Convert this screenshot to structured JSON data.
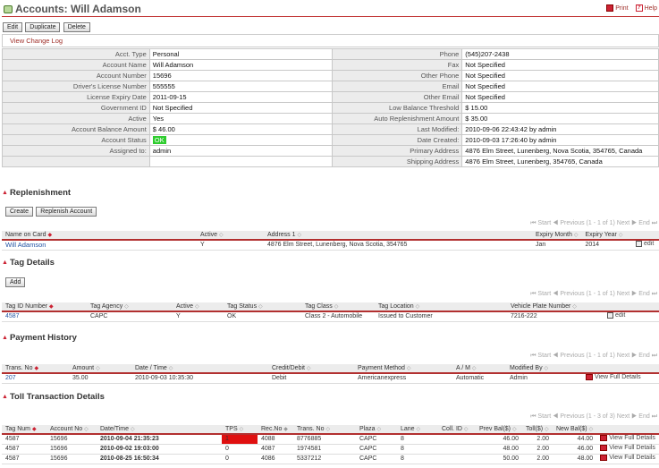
{
  "header": {
    "title": "Accounts: Will Adamson",
    "print": "Print",
    "help": "Help"
  },
  "toolbar": {
    "edit": "Edit",
    "duplicate": "Duplicate",
    "delete": "Delete"
  },
  "change_log": "View Change Log",
  "account": {
    "left": [
      [
        "Acct. Type",
        "Personal"
      ],
      [
        "Account Name",
        "Will Adamson"
      ],
      [
        "Account Number",
        "15696"
      ],
      [
        "Driver's License Number",
        "555555"
      ],
      [
        "License Expiry Date",
        "2011-09-15"
      ],
      [
        "Government ID",
        "Not Specified"
      ],
      [
        "Active",
        "Yes"
      ],
      [
        "Account Balance Amount",
        "$ 46.00"
      ],
      [
        "Account Status",
        "OK"
      ],
      [
        "Assigned to:",
        "admin"
      ]
    ],
    "right": [
      [
        "Phone",
        "(545)207-2438"
      ],
      [
        "Fax",
        "Not Specified"
      ],
      [
        "Other Phone",
        "Not Specified"
      ],
      [
        "Email",
        "Not Specified"
      ],
      [
        "Other Email",
        "Not Specified"
      ],
      [
        "Low Balance Threshold",
        "$ 15.00"
      ],
      [
        "Auto Replenishment Amount",
        "$ 35.00"
      ],
      [
        "Last Modified:",
        "2010-09-06 22:43:42 by admin"
      ],
      [
        "Date Created:",
        "2010-09-03 17:26:40 by admin"
      ],
      [
        "Primary Address",
        "4876 Elm Street, Lunenberg, Nova Scotia, 354765, Canada"
      ],
      [
        "Shipping Address",
        "4876 Elm Street, Lunenberg, 354765, Canada"
      ]
    ]
  },
  "replenishment": {
    "title": "Replenishment",
    "buttons": {
      "create": "Create",
      "replenish": "Replenish Account"
    },
    "pager": "⏮ Start ◀ Previous (1 - 1 of 1) Next ▶ End ⏭",
    "columns": [
      "Name on Card",
      "Active",
      "Address 1",
      "Expiry Month",
      "Expiry Year"
    ],
    "rows": [
      [
        "Will Adamson",
        "Y",
        "4876 Elm Street, Lunenberg, Nova Scotia, 354765",
        "Jan",
        "2014"
      ]
    ],
    "edit": "edit"
  },
  "tags": {
    "title": "Tag Details",
    "buttons": {
      "add": "Add"
    },
    "pager": "⏮ Start ◀ Previous (1 - 1 of 1) Next ▶ End ⏭",
    "columns": [
      "Tag ID Number",
      "Tag Agency",
      "Active",
      "Tag Status",
      "Tag Class",
      "Tag Location",
      "Vehicle Plate Number"
    ],
    "rows": [
      [
        "4587",
        "CAPC",
        "Y",
        "OK",
        "Class 2 - Automobile",
        "Issued to Customer",
        "7216-222"
      ]
    ],
    "edit": "edit"
  },
  "payments": {
    "title": "Payment History",
    "pager": "⏮ Start ◀ Previous (1 - 1 of 1) Next ▶ End ⏭",
    "columns": [
      "Trans. No",
      "Amount",
      "Date / Time",
      "Credit/Debit",
      "Payment Method",
      "A / M",
      "Modified By"
    ],
    "rows": [
      [
        "207",
        "35.00",
        "2010-09-03 10:35:30",
        "Debit",
        "Americanexpress",
        "Automatic",
        "Admin"
      ]
    ],
    "details": "View Full Details"
  },
  "tolls": {
    "title": "Toll Transaction  Details",
    "pager": "⏮ Start ◀ Previous (1 - 3 of 3) Next ▶ End ⏭",
    "columns": [
      "Tag Num",
      "Account No",
      "Date/Time",
      "TPS",
      "Rec.No",
      "Trans. No",
      "Plaza",
      "Lane",
      "Coll. ID",
      "Prev Bal($)",
      "Toll($)",
      "New Bal($)"
    ],
    "rows": [
      [
        "4587",
        "15696",
        "2010-09-04 21:35:23",
        "1",
        "4088",
        "8776885",
        "CAPC",
        "8",
        "",
        "46.00",
        "2.00",
        "44.00"
      ],
      [
        "4587",
        "15696",
        "2010-09-02 19:03:00",
        "0",
        "4087",
        "1974581",
        "CAPC",
        "8",
        "",
        "48.00",
        "2.00",
        "46.00"
      ],
      [
        "4587",
        "15696",
        "2010-08-25 16:50:34",
        "0",
        "4086",
        "5337212",
        "CAPC",
        "8",
        "",
        "50.00",
        "2.00",
        "48.00"
      ]
    ],
    "details": "View Full Details"
  }
}
